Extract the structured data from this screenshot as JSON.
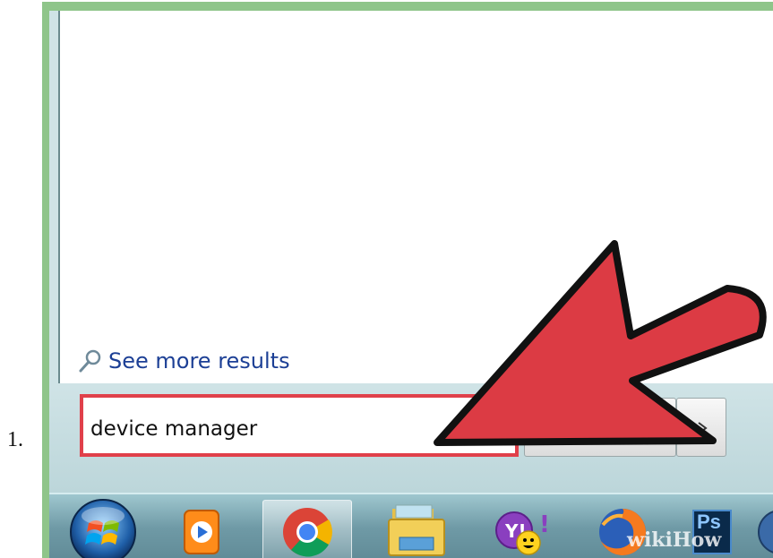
{
  "step": {
    "number": "1."
  },
  "start_menu": {
    "more_results_label": "See more results",
    "search_value": "device manager"
  },
  "taskbar": {
    "items": [
      {
        "name": "start-button",
        "icon": "windows-orb-icon"
      },
      {
        "name": "media-player",
        "icon": "windows-media-player-icon"
      },
      {
        "name": "chrome",
        "icon": "chrome-icon"
      },
      {
        "name": "file-explorer",
        "icon": "folder-icon"
      },
      {
        "name": "yahoo-messenger",
        "icon": "yahoo-messenger-icon"
      },
      {
        "name": "firefox",
        "icon": "firefox-icon"
      },
      {
        "name": "photoshop",
        "icon": "photoshop-icon",
        "label": "Ps"
      }
    ]
  },
  "watermark": "wikiHow",
  "colors": {
    "frame_green": "#8fc58a",
    "highlight_red": "#e0404a",
    "arrow_red": "#dc3b44",
    "link_blue": "#1c3f95"
  }
}
